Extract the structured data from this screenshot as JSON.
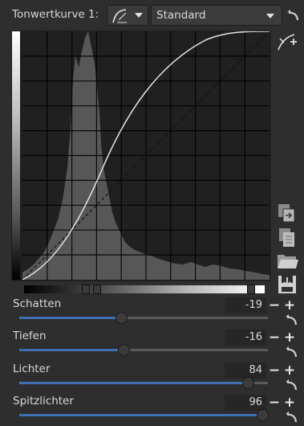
{
  "header": {
    "title": "Tonwertkurve 1:",
    "curve_type_icon": "curve-pen-icon",
    "preset_value": "Standard"
  },
  "tools": [
    "edit-points-icon",
    "copy-icon",
    "paste-icon",
    "open-folder-icon",
    "save-icon"
  ],
  "sliders": [
    {
      "label": "Schatten",
      "value": "-19",
      "minus": "−",
      "plus": "+",
      "level": 0.41
    },
    {
      "label": "Tiefen",
      "value": "-16",
      "minus": "−",
      "plus": "+",
      "level": 0.42
    },
    {
      "label": "Lichter",
      "value": "84",
      "minus": "−",
      "plus": "+",
      "level": 0.92
    },
    {
      "label": "Spitzlichter",
      "value": "96",
      "minus": "−",
      "plus": "+",
      "level": 0.98
    }
  ]
}
